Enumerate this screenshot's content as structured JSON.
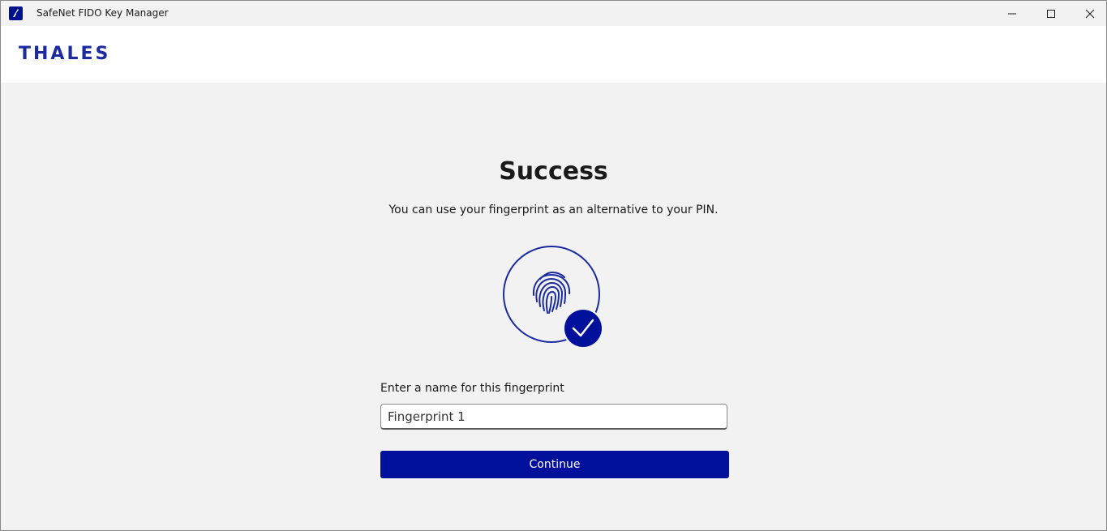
{
  "window": {
    "title": "SafeNet FIDO Key Manager"
  },
  "header": {
    "logo_text": "THALES"
  },
  "main": {
    "title": "Success",
    "subtitle": "You can use your fingerprint as an alternative to your PIN.",
    "illustration_icon": "fingerprint-check-icon",
    "name_field": {
      "label": "Enter a name for this fingerprint",
      "value": "Fingerprint 1"
    },
    "continue_label": "Continue"
  },
  "colors": {
    "brand_blue": "#00109a",
    "logo_blue": "#1b2aa0",
    "background": "#f2f2f2"
  }
}
